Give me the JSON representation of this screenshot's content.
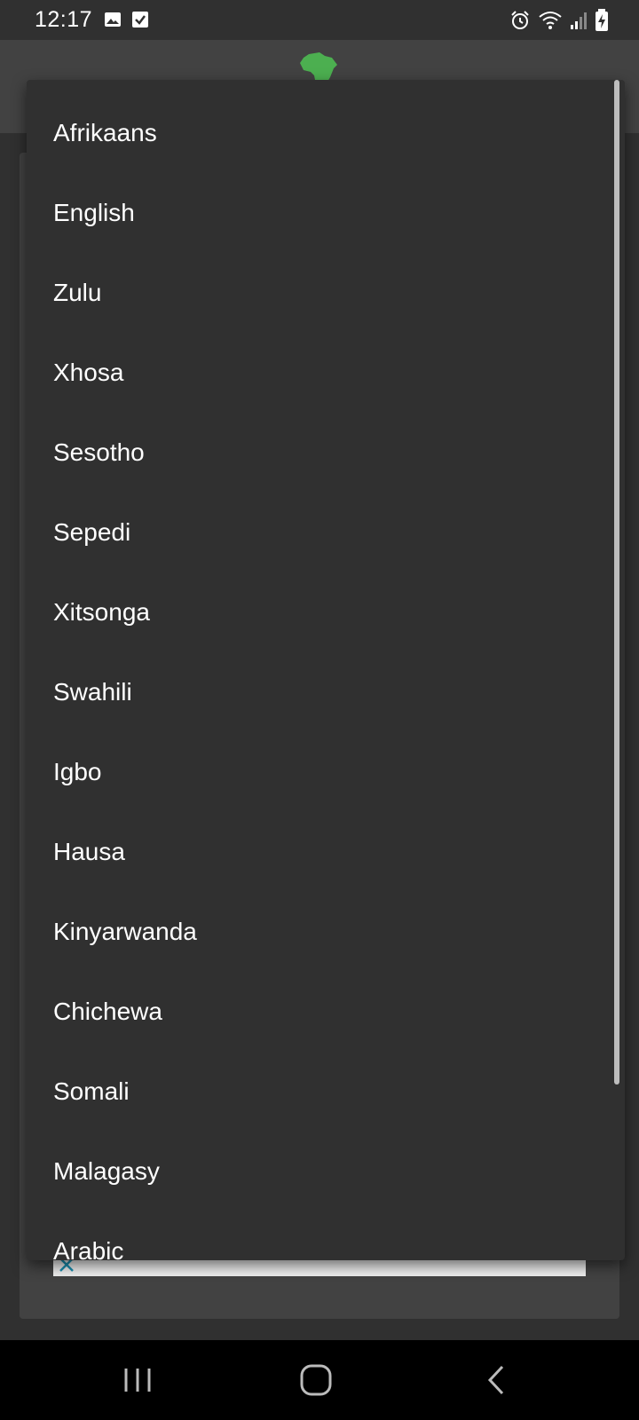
{
  "status_bar": {
    "time": "12:17",
    "left_icons": [
      "image-icon",
      "checkbox-icon"
    ],
    "right_icons": [
      "alarm-icon",
      "wifi-icon",
      "signal-icon",
      "battery-charging-icon"
    ]
  },
  "app_bar": {
    "logo_icon": "africa-map-icon",
    "logo_color": "#4caf50"
  },
  "menu": {
    "items": [
      "Afrikaans",
      "English",
      "Zulu",
      "Xhosa",
      "Sesotho",
      "Sepedi",
      "Xitsonga",
      "Swahili",
      "Igbo",
      "Hausa",
      "Kinyarwanda",
      "Chichewa",
      "Somali",
      "Malagasy",
      "Arabic"
    ]
  },
  "nav_bar": {
    "icons": [
      "recent-apps-icon",
      "home-icon",
      "back-icon"
    ]
  }
}
